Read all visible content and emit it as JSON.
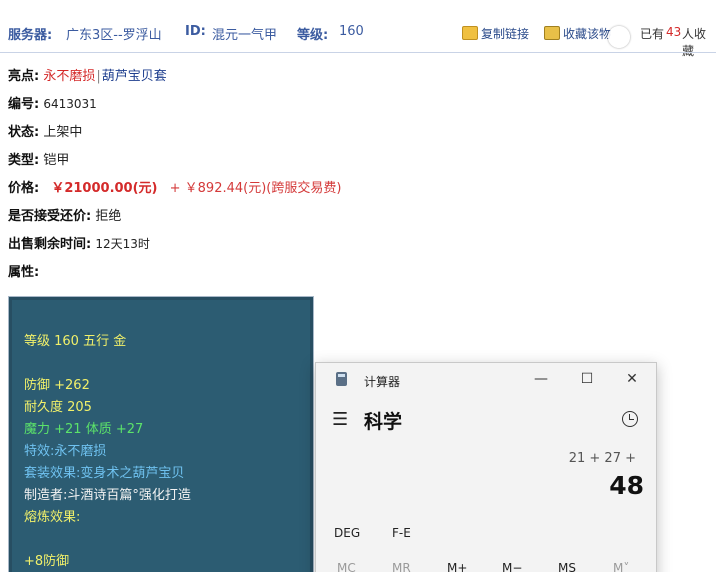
{
  "header": {
    "server_label": "服务器:",
    "server_value": "广东3区--罗浮山",
    "id_label": "ID:",
    "id_value": "混元一气甲",
    "level_label": "等级:",
    "level_value": "160",
    "copy_link": "复制链接",
    "favorite": "收藏该物",
    "favorite_count_prefix": "已有",
    "favorite_count": "43",
    "favorite_suffix": "人收藏"
  },
  "details": {
    "highlight_label": "亮点:",
    "highlight_1": "永不磨损",
    "highlight_sep": "|",
    "highlight_2": "葫芦宝贝套",
    "number_label": "编号:",
    "number_value": "6413031",
    "status_label": "状态:",
    "status_value": "上架中",
    "type_label": "类型:",
    "type_value": "铠甲",
    "price_label": "价格:",
    "price_value": "￥21000.00(元)",
    "fee_value": "+ ￥892.44(元)(跨服交易费)",
    "bargain_label": "是否接受还价:",
    "bargain_value": "拒绝",
    "remaining_label": "出售剩余时间:",
    "remaining_value": "12天13时",
    "attr_label": "属性:"
  },
  "attributes": {
    "level_line": "等级 160 五行 金",
    "defense": "防御 +262",
    "durability": "耐久度 205",
    "stats": "魔力 +21 体质 +27",
    "special": "特效:永不磨损",
    "set_effect": "套装效果:变身术之葫芦宝贝",
    "maker": "制造者:斗酒诗百篇°强化打造",
    "refine": "熔炼效果:",
    "refine_value": "+8防御"
  },
  "calculator": {
    "title": "计算器",
    "mode": "科学",
    "expression": "21 + 27 +",
    "result": "48",
    "deg": "DEG",
    "fe": "F-E",
    "mc": "MC",
    "mr": "MR",
    "mplus": "M+",
    "mminus": "M−",
    "ms": "MS",
    "mv": "M˅"
  },
  "colors": {
    "accent": "#3b5ba0",
    "price_red": "#d42a2a",
    "panel_bg": "#2c5c72"
  }
}
